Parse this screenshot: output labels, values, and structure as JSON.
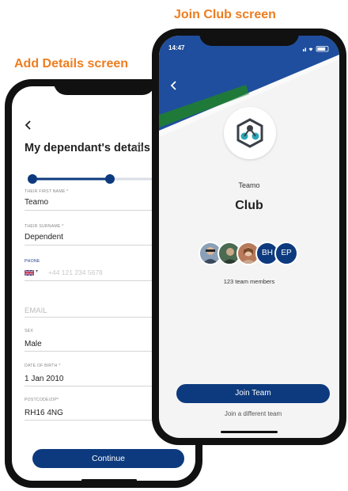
{
  "captions": {
    "join_club": "Join Club screen",
    "add_details": "Add Details screen"
  },
  "add_details": {
    "back_icon": "chevron-left-icon",
    "title": "My dependant's details",
    "info_icon": "info-icon",
    "progress": {
      "steps": 3,
      "current_step": 2
    },
    "fields": {
      "first_name": {
        "label": "THEIR FIRST NAME *",
        "value": "Teamo"
      },
      "surname": {
        "label": "THEIR SURNAME *",
        "value": "Dependent"
      },
      "phone": {
        "label": "PHONE",
        "placeholder": "+44 121 234 5678",
        "country_caret": "▾"
      },
      "email": {
        "placeholder": "EMAIL"
      },
      "sex": {
        "label": "SEX",
        "value": "Male"
      },
      "dob": {
        "label": "DATE OF BIRTH *",
        "value": "1 Jan 2010"
      },
      "postcode": {
        "label": "POSTCODE/ZIP*",
        "value": "RH16 4NG"
      }
    },
    "continue_label": "Continue"
  },
  "join_club": {
    "status_time": "14:47",
    "back_icon": "chevron-left-icon",
    "club_name_small": "Teamo",
    "club_name_big": "Club",
    "avatars": [
      {
        "type": "photo"
      },
      {
        "type": "photo"
      },
      {
        "type": "photo"
      },
      {
        "type": "initials",
        "text": "BH"
      },
      {
        "type": "initials",
        "text": "EP"
      }
    ],
    "members_text": "123 team members",
    "join_label": "Join Team",
    "different_team_label": "Join a different team",
    "colors": {
      "primary": "#0d3a7e",
      "band_blue": "#1f4e9e",
      "band_green": "#1f7a3a",
      "accent": "#ee7d1f"
    }
  }
}
